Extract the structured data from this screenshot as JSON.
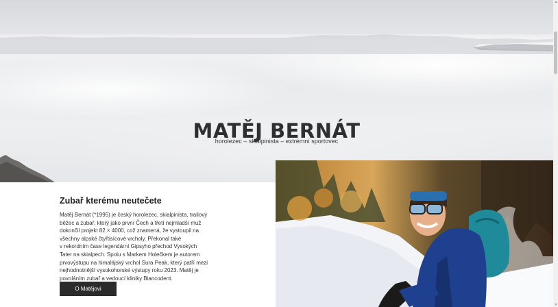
{
  "hero": {
    "title": "MATĚJ BERNÁT",
    "subtitle": "horolezec – skialpinista – extrémní sportovec"
  },
  "about": {
    "heading": "Zubař kterému neutečete",
    "paragraph": "Matěj Bernát (*1995) je český horolezec, skialpinista, trailový\nběžec a zubař, který jako první Čech a třetí nejmladší muž\ndokončil projekt 82 × 4000, což znamená, že vystoupil na\nvšechny alpské čtyřtisícové vrcholy. Překonal také\nv rekordním čase legendární Gipsyho přechod Vysokých\nTater na skialpech. Spolu s Markem Holečkem je autorem\nprvovýstupu na himalájský vrchol Sura Peak, který patří mezi\nnejhodnotnější vysokohorské výstupy roku 2023. Matěj je\npovoláním zubař a vedoucí kliniky Biancodent.",
    "button_label": "O Matějovi"
  },
  "colors": {
    "title": "#2f2f2f",
    "button_bg": "#2b2b2b",
    "button_text": "#ffffff",
    "jacket": "#1f3f8f",
    "backpack": "#1f8a9a"
  }
}
